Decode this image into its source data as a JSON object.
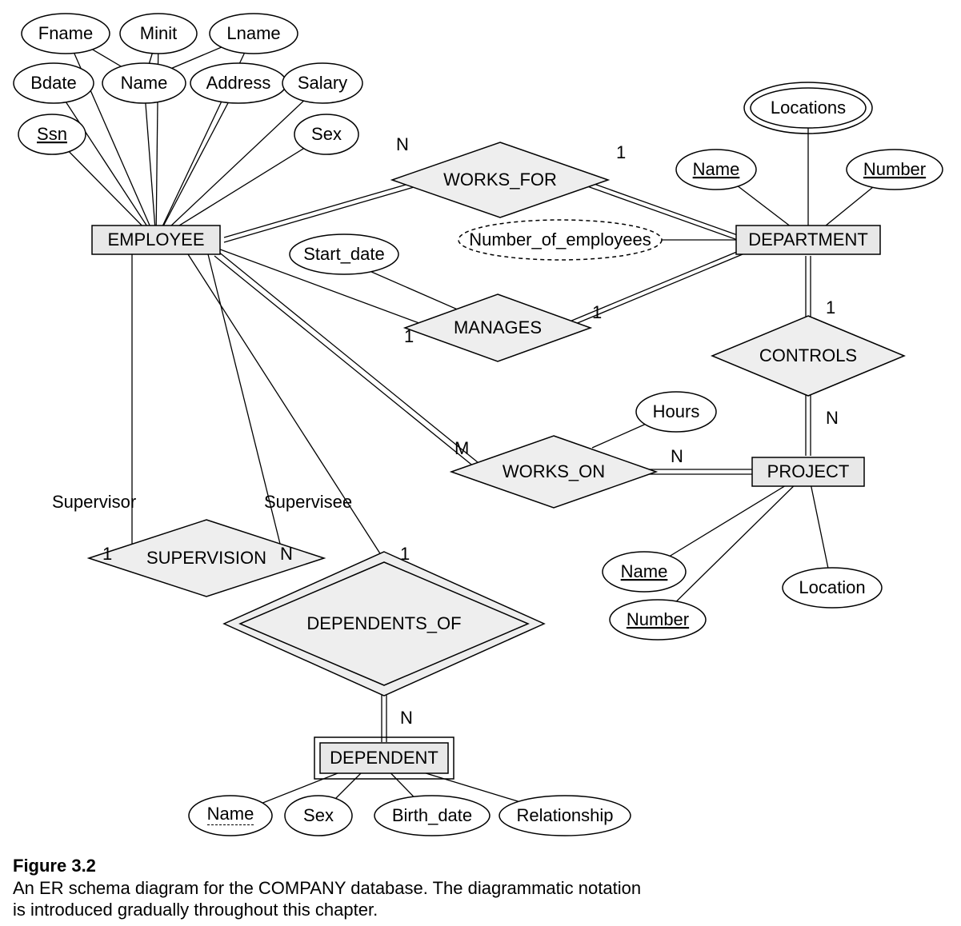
{
  "entities": {
    "employee": "EMPLOYEE",
    "department": "DEPARTMENT",
    "project": "PROJECT",
    "dependent": "DEPENDENT"
  },
  "relationships": {
    "works_for": "WORKS_FOR",
    "manages": "MANAGES",
    "controls": "CONTROLS",
    "works_on": "WORKS_ON",
    "supervision": "SUPERVISION",
    "dependents_of": "DEPENDENTS_OF"
  },
  "attributes": {
    "employee": {
      "fname": "Fname",
      "minit": "Minit",
      "lname": "Lname",
      "bdate": "Bdate",
      "name": "Name",
      "address": "Address",
      "salary": "Salary",
      "ssn": "Ssn",
      "sex": "Sex"
    },
    "department": {
      "locations": "Locations",
      "name": "Name",
      "number": "Number",
      "number_of_employees": "Number_of_employees"
    },
    "project": {
      "name": "Name",
      "number": "Number",
      "location": "Location"
    },
    "dependent": {
      "name": "Name",
      "sex": "Sex",
      "birth_date": "Birth_date",
      "relationship": "Relationship"
    },
    "manages": {
      "start_date": "Start_date"
    },
    "works_on": {
      "hours": "Hours"
    }
  },
  "roles": {
    "supervisor": "Supervisor",
    "supervisee": "Supervisee"
  },
  "cardinalities": {
    "works_for_emp": "N",
    "works_for_dept": "1",
    "manages_emp": "1",
    "manages_dept": "1",
    "controls_dept": "1",
    "controls_proj": "N",
    "works_on_emp": "M",
    "works_on_proj": "N",
    "supervision_supervisor": "1",
    "supervision_supervisee": "N",
    "dependents_of_emp": "1",
    "dependents_of_dep": "N"
  },
  "caption": {
    "title": "Figure 3.2",
    "line1": "An ER schema diagram for the COMPANY database. The diagrammatic notation",
    "line2": "is introduced gradually throughout this chapter."
  }
}
